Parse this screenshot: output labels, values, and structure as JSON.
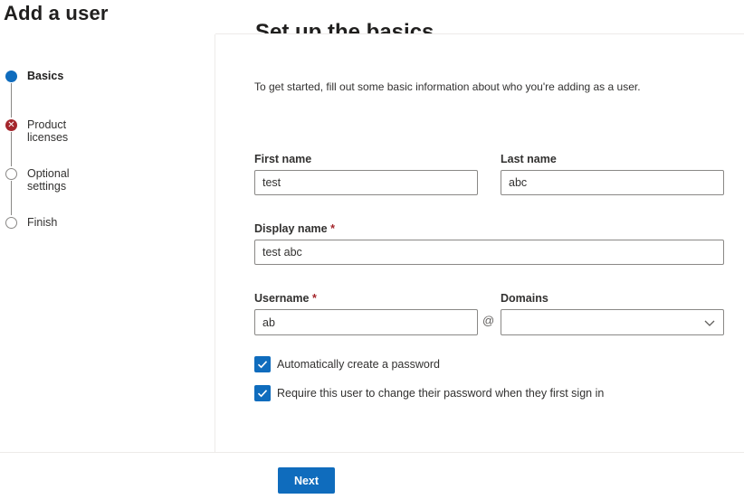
{
  "page": {
    "title": "Add a user"
  },
  "stepper": {
    "steps": [
      {
        "label": "Basics",
        "state": "active"
      },
      {
        "label": "Product licenses",
        "state": "error"
      },
      {
        "label": "Optional settings",
        "state": "pending"
      },
      {
        "label": "Finish",
        "state": "pending"
      }
    ],
    "error_glyph": "✕"
  },
  "form": {
    "heading": "Set up the basics",
    "intro": "To get started, fill out some basic information about who you're adding as a user.",
    "first_name": {
      "label": "First name",
      "value": "test"
    },
    "last_name": {
      "label": "Last name",
      "value": "abc"
    },
    "display_name": {
      "label": "Display name",
      "required_mark": "*",
      "value": "test abc"
    },
    "username": {
      "label": "Username",
      "required_mark": "*",
      "value": "ab"
    },
    "at_sign": "@",
    "domains": {
      "label": "Domains",
      "value": ""
    },
    "auto_password": {
      "label": "Automatically create a password",
      "checked": true
    },
    "require_change": {
      "label": "Require this user to change their password when they first sign in",
      "checked": true
    }
  },
  "footer": {
    "next_label": "Next"
  },
  "colors": {
    "accent": "#0f6cbd",
    "error": "#a4262c",
    "border": "#8a8886"
  }
}
